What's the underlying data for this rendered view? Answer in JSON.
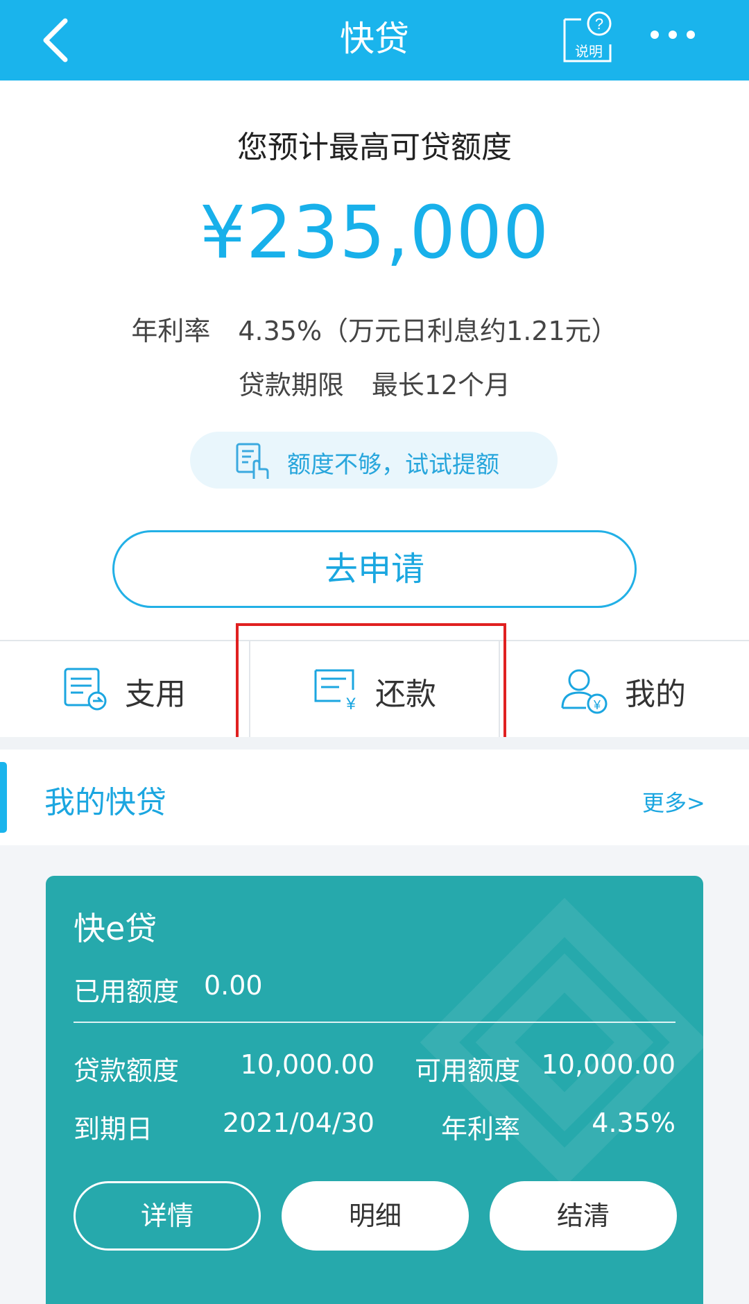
{
  "header": {
    "title": "快贷",
    "help_label": "说明"
  },
  "hero": {
    "subtitle": "您预计最高可贷额度",
    "amount": "¥235,000",
    "rate_label": "年利率",
    "rate_value": "4.35%（万元日利息约1.21元）",
    "term_label": "贷款期限",
    "term_value": "最长12个月",
    "raise_text": "额度不够，试试提额",
    "apply_label": "去申请"
  },
  "actions": [
    {
      "label": "支用",
      "icon": "draw-funds-icon"
    },
    {
      "label": "还款",
      "icon": "repay-icon"
    },
    {
      "label": "我的",
      "icon": "user-yuan-icon"
    }
  ],
  "section": {
    "title": "我的快贷",
    "more": "更多>"
  },
  "card": {
    "title": "快e贷",
    "used_label": "已用额度",
    "used_value": "0.00",
    "loan_limit_label": "贷款额度",
    "loan_limit_value": "10,000.00",
    "available_label": "可用额度",
    "available_value": "10,000.00",
    "due_label": "到期日",
    "due_value": "2021/04/30",
    "rate_label": "年利率",
    "rate_value": "4.35%",
    "buttons": [
      "详情",
      "明细",
      "结清"
    ]
  },
  "colors": {
    "brand_blue": "#1ab4ec",
    "card_teal": "#26a9ac",
    "highlight_red": "#e02020"
  }
}
